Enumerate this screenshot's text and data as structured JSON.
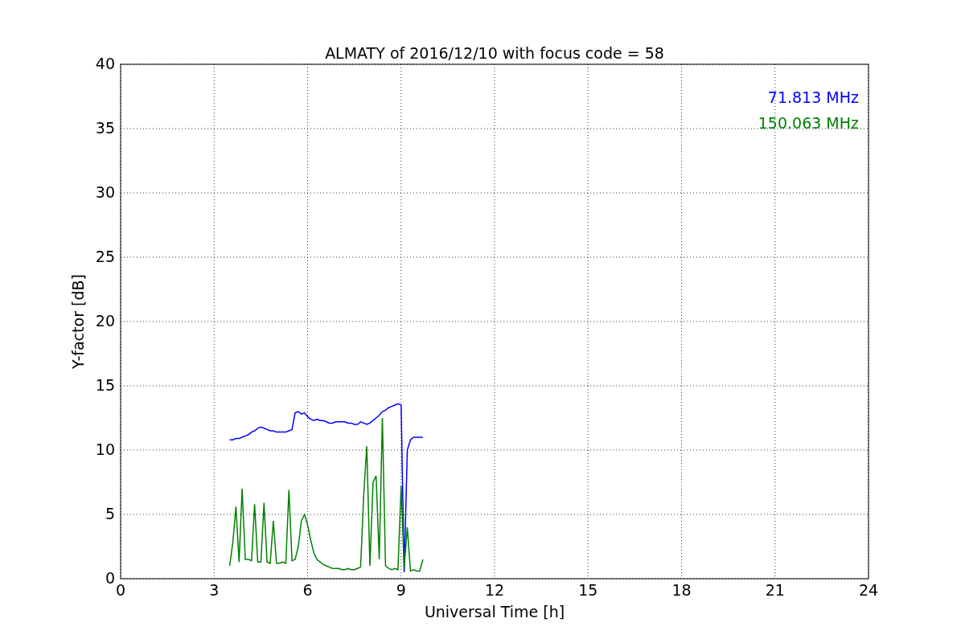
{
  "chart_data": {
    "type": "line",
    "title": "ALMATY of 2016/12/10 with focus code = 58",
    "xlabel": "Universal Time [h]",
    "ylabel": "Y-factor [dB]",
    "x": [
      3.5,
      3.6,
      3.7,
      3.8,
      3.9,
      4.0,
      4.1,
      4.2,
      4.3,
      4.4,
      4.5,
      4.6,
      4.7,
      4.8,
      4.9,
      5.0,
      5.1,
      5.2,
      5.3,
      5.4,
      5.5,
      5.6,
      5.7,
      5.8,
      5.9,
      6.0,
      6.1,
      6.2,
      6.3,
      6.4,
      6.5,
      6.6,
      6.7,
      6.8,
      6.9,
      7.0,
      7.1,
      7.2,
      7.3,
      7.4,
      7.5,
      7.6,
      7.7,
      7.8,
      7.9,
      8.0,
      8.1,
      8.2,
      8.3,
      8.4,
      8.5,
      8.6,
      8.7,
      8.8,
      8.9,
      9.0,
      9.1,
      9.2,
      9.3,
      9.4,
      9.5,
      9.6,
      9.7
    ],
    "series": [
      {
        "name": "71.813 MHz",
        "color": "#0000ff",
        "values": [
          10.8,
          10.8,
          10.9,
          10.9,
          11.0,
          11.1,
          11.2,
          11.4,
          11.5,
          11.7,
          11.8,
          11.7,
          11.6,
          11.5,
          11.5,
          11.4,
          11.4,
          11.4,
          11.4,
          11.5,
          11.6,
          12.9,
          13.0,
          12.8,
          12.9,
          12.6,
          12.4,
          12.3,
          12.4,
          12.3,
          12.3,
          12.2,
          12.1,
          12.1,
          12.2,
          12.2,
          12.2,
          12.2,
          12.1,
          12.1,
          12.0,
          12.0,
          12.2,
          12.1,
          12.0,
          12.1,
          12.3,
          12.5,
          12.7,
          13.0,
          13.1,
          13.3,
          13.4,
          13.5,
          13.6,
          13.5,
          0.5,
          10.0,
          10.8,
          11.0,
          11.0,
          11.0,
          11.0
        ]
      },
      {
        "name": "150.063 MHz",
        "color": "#008000",
        "values": [
          1.0,
          2.8,
          5.6,
          1.3,
          7.0,
          1.5,
          1.5,
          1.4,
          5.8,
          1.3,
          1.3,
          5.9,
          1.3,
          1.2,
          4.5,
          1.2,
          1.2,
          1.3,
          1.2,
          6.9,
          1.4,
          1.5,
          2.5,
          4.5,
          5.0,
          4.2,
          3.0,
          2.0,
          1.5,
          1.3,
          1.1,
          1.0,
          0.9,
          0.8,
          0.8,
          0.8,
          0.7,
          0.7,
          0.8,
          0.7,
          0.7,
          0.8,
          0.9,
          6.5,
          10.3,
          1.0,
          7.5,
          8.0,
          1.5,
          12.5,
          1.0,
          0.8,
          0.7,
          0.8,
          0.7,
          7.2,
          0.8,
          4.0,
          0.6,
          0.7,
          0.6,
          0.6,
          1.5
        ]
      }
    ],
    "xlim": [
      0,
      24
    ],
    "ylim": [
      0,
      40
    ],
    "xticks": [
      0,
      3,
      6,
      9,
      12,
      15,
      18,
      21,
      24
    ],
    "yticks": [
      0,
      5,
      10,
      15,
      20,
      25,
      30,
      35,
      40
    ],
    "grid": true
  }
}
